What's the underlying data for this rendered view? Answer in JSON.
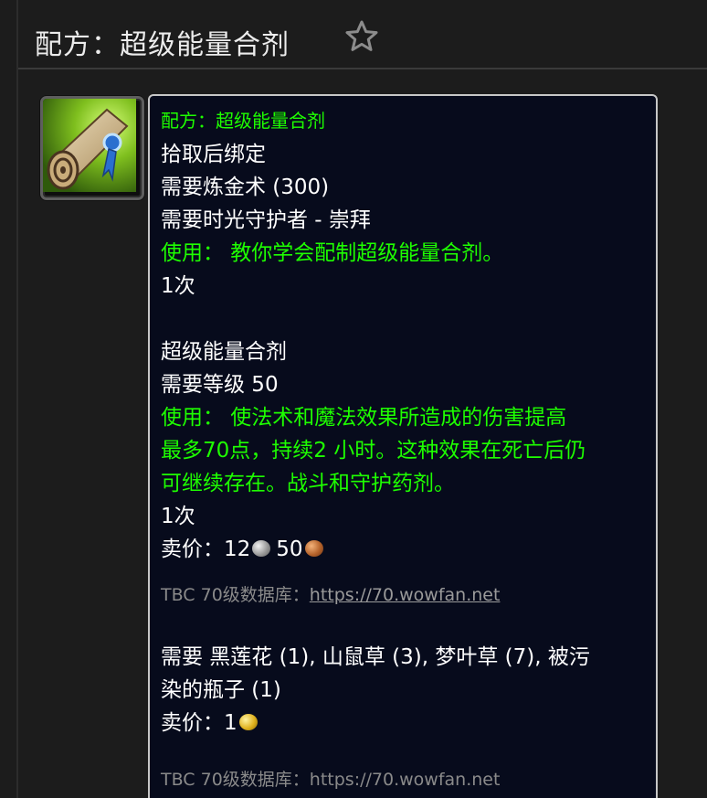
{
  "header": {
    "title": "配方：超级能量合剂"
  },
  "icons": {
    "favorite": "star-outline-icon",
    "item": "recipe-scroll-icon",
    "silver": "silver-coin-icon",
    "copper": "copper-coin-icon",
    "gold": "gold-coin-icon"
  },
  "colors": {
    "item_name": "#1eff00",
    "use_text": "#1eff00",
    "tooltip_bg": "#070b1c",
    "tooltip_border": "#c7c7c7"
  },
  "tooltip": {
    "item_name": "配方：超级能量合剂",
    "bind": "拾取后绑定",
    "req_skill": "需要炼金术 (300)",
    "req_rep": "需要时光守护者 - 崇拜",
    "use_recipe": "使用： 教你学会配制超级能量合剂。",
    "charges_1": "1次",
    "created_name": "超级能量合剂",
    "req_level": "需要等级 50",
    "use_effect_lines": [
      "使用： 使法术和魔法效果所造成的伤害提高",
      "最多70点，持续2 小时。这种效果在死亡后仍",
      "可继续存在。战斗和守护药剂。"
    ],
    "charges_2": "1次",
    "sell_label": "卖价：",
    "sell_silver": "12",
    "sell_copper": "50",
    "db_label": "TBC 70级数据库：",
    "db_url": "https://70.wowfan.net",
    "reagents_lines": [
      "需要 黑莲花 (1), 山鼠草 (3), 梦叶草 (7), 被污",
      "染的瓶子 (1)"
    ],
    "sell_label_2": "卖价：",
    "sell_gold": "1",
    "db_cutoff": "TBC 70级数据库：https://70.wowfan.net"
  }
}
